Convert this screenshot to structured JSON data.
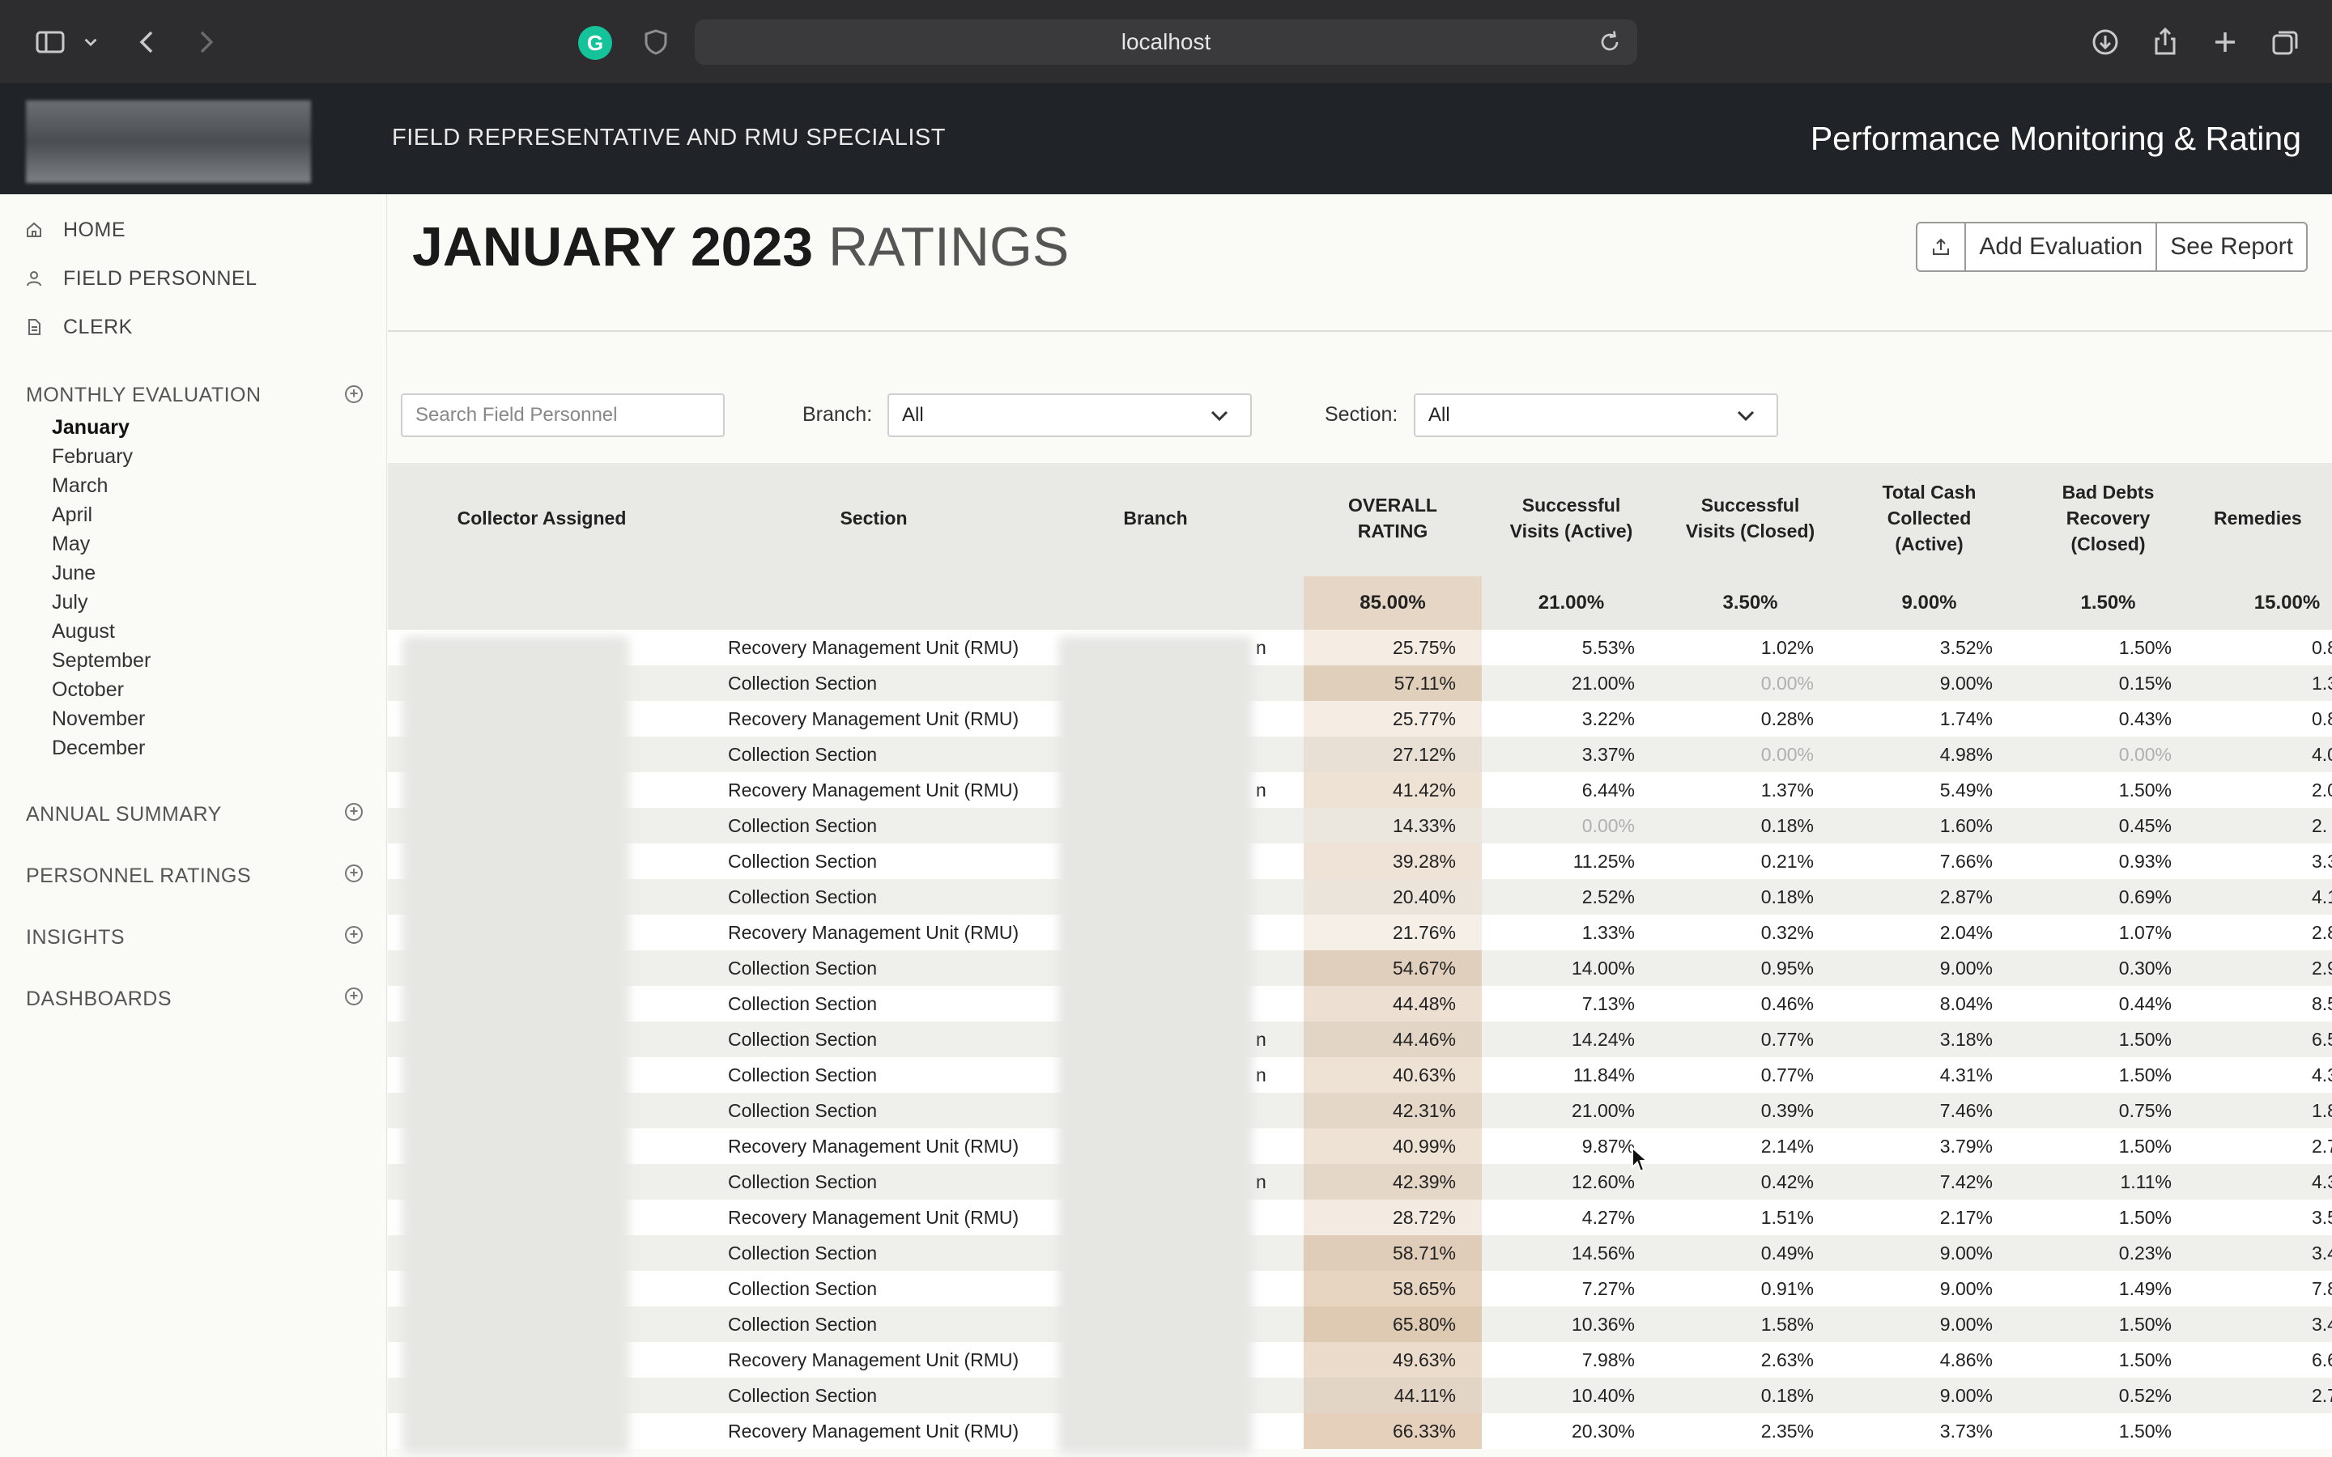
{
  "browser": {
    "url": "localhost"
  },
  "app": {
    "subtitle": "FIELD REPRESENTATIVE AND RMU SPECIALIST",
    "title": "Performance Monitoring & Rating"
  },
  "sidebar": {
    "nav": [
      {
        "label": "HOME",
        "icon": "home-icon"
      },
      {
        "label": "FIELD PERSONNEL",
        "icon": "person-icon"
      },
      {
        "label": "CLERK",
        "icon": "document-icon"
      }
    ],
    "monthly_evaluation": "MONTHLY EVALUATION",
    "months": [
      "January",
      "February",
      "March",
      "April",
      "May",
      "June",
      "July",
      "August",
      "September",
      "October",
      "November",
      "December"
    ],
    "active_month": "January",
    "sections": [
      "ANNUAL SUMMARY",
      "PERSONNEL RATINGS",
      "INSIGHTS",
      "DASHBOARDS"
    ]
  },
  "page": {
    "title_bold": "JANUARY 2023",
    "title_light": "RATINGS",
    "add_evaluation": "Add Evaluation",
    "see_report": "See Report"
  },
  "filters": {
    "search_placeholder": "Search Field Personnel",
    "branch_label": "Branch:",
    "branch_value": "All",
    "section_label": "Section:",
    "section_value": "All"
  },
  "table": {
    "headers": {
      "collector": "Collector Assigned",
      "section": "Section",
      "branch": "Branch",
      "rating_l1": "OVERALL",
      "rating_l2": "RATING",
      "sva_l1": "Successful",
      "sva_l2": "Visits (Active)",
      "svc_l1": "Successful",
      "svc_l2": "Visits (Closed)",
      "tcc_l1": "Total Cash",
      "tcc_l2": "Collected",
      "tcc_l3": "(Active)",
      "bdr_l1": "Bad Debts",
      "bdr_l2": "Recovery",
      "bdr_l3": "(Closed)",
      "rem": "Remedies"
    },
    "weights": {
      "rating": "85.00%",
      "sva": "21.00%",
      "svc": "3.50%",
      "tcc": "9.00%",
      "bdr": "1.50%",
      "rem": "15.00%"
    },
    "rows": [
      {
        "section": "Recovery Management Unit (RMU)",
        "rating": "25.75%",
        "sva": "5.53%",
        "svc": "1.02%",
        "tcc": "3.52%",
        "bdr": "1.50%",
        "rem": "0.8",
        "tail": "n",
        "r": 0.26
      },
      {
        "section": "Collection Section",
        "rating": "57.11%",
        "sva": "21.00%",
        "svc": "0.00%",
        "tcc": "9.00%",
        "bdr": "0.15%",
        "rem": "1.3",
        "tail": "",
        "r": 0.57
      },
      {
        "section": "Recovery Management Unit (RMU)",
        "rating": "25.77%",
        "sva": "3.22%",
        "svc": "0.28%",
        "tcc": "1.74%",
        "bdr": "0.43%",
        "rem": "0.8",
        "tail": "",
        "r": 0.26
      },
      {
        "section": "Collection Section",
        "rating": "27.12%",
        "sva": "3.37%",
        "svc": "0.00%",
        "tcc": "4.98%",
        "bdr": "0.00%",
        "rem": "4.0",
        "tail": "",
        "r": 0.27
      },
      {
        "section": "Recovery Management Unit (RMU)",
        "rating": "41.42%",
        "sva": "6.44%",
        "svc": "1.37%",
        "tcc": "5.49%",
        "bdr": "1.50%",
        "rem": "2.0",
        "tail": "n",
        "r": 0.41
      },
      {
        "section": "Collection Section",
        "rating": "14.33%",
        "sva": "0.00%",
        "svc": "0.18%",
        "tcc": "1.60%",
        "bdr": "0.45%",
        "rem": "2.",
        "tail": "",
        "r": 0.14
      },
      {
        "section": "Collection Section",
        "rating": "39.28%",
        "sva": "11.25%",
        "svc": "0.21%",
        "tcc": "7.66%",
        "bdr": "0.93%",
        "rem": "3.3",
        "tail": "",
        "r": 0.39
      },
      {
        "section": "Collection Section",
        "rating": "20.40%",
        "sva": "2.52%",
        "svc": "0.18%",
        "tcc": "2.87%",
        "bdr": "0.69%",
        "rem": "4.1",
        "tail": "",
        "r": 0.2
      },
      {
        "section": "Recovery Management Unit (RMU)",
        "rating": "21.76%",
        "sva": "1.33%",
        "svc": "0.32%",
        "tcc": "2.04%",
        "bdr": "1.07%",
        "rem": "2.8",
        "tail": "",
        "r": 0.22
      },
      {
        "section": "Collection Section",
        "rating": "54.67%",
        "sva": "14.00%",
        "svc": "0.95%",
        "tcc": "9.00%",
        "bdr": "0.30%",
        "rem": "2.9",
        "tail": "",
        "r": 0.55
      },
      {
        "section": "Collection Section",
        "rating": "44.48%",
        "sva": "7.13%",
        "svc": "0.46%",
        "tcc": "8.04%",
        "bdr": "0.44%",
        "rem": "8.5",
        "tail": "",
        "r": 0.44
      },
      {
        "section": "Collection Section",
        "rating": "44.46%",
        "sva": "14.24%",
        "svc": "0.77%",
        "tcc": "3.18%",
        "bdr": "1.50%",
        "rem": "6.5",
        "tail": "n",
        "r": 0.44
      },
      {
        "section": "Collection Section",
        "rating": "40.63%",
        "sva": "11.84%",
        "svc": "0.77%",
        "tcc": "4.31%",
        "bdr": "1.50%",
        "rem": "4.3",
        "tail": "n",
        "r": 0.41
      },
      {
        "section": "Collection Section",
        "rating": "42.31%",
        "sva": "21.00%",
        "svc": "0.39%",
        "tcc": "7.46%",
        "bdr": "0.75%",
        "rem": "1.8",
        "tail": "",
        "r": 0.42
      },
      {
        "section": "Recovery Management Unit (RMU)",
        "rating": "40.99%",
        "sva": "9.87%",
        "svc": "2.14%",
        "tcc": "3.79%",
        "bdr": "1.50%",
        "rem": "2.7",
        "tail": "",
        "r": 0.41
      },
      {
        "section": "Collection Section",
        "rating": "42.39%",
        "sva": "12.60%",
        "svc": "0.42%",
        "tcc": "7.42%",
        "bdr": "1.11%",
        "rem": "4.3",
        "tail": "n",
        "r": 0.42
      },
      {
        "section": "Recovery Management Unit (RMU)",
        "rating": "28.72%",
        "sva": "4.27%",
        "svc": "1.51%",
        "tcc": "2.17%",
        "bdr": "1.50%",
        "rem": "3.5",
        "tail": "",
        "r": 0.29
      },
      {
        "section": "Collection Section",
        "rating": "58.71%",
        "sva": "14.56%",
        "svc": "0.49%",
        "tcc": "9.00%",
        "bdr": "0.23%",
        "rem": "3.4",
        "tail": "",
        "r": 0.59
      },
      {
        "section": "Collection Section",
        "rating": "58.65%",
        "sva": "7.27%",
        "svc": "0.91%",
        "tcc": "9.00%",
        "bdr": "1.49%",
        "rem": "7.8",
        "tail": "",
        "r": 0.59
      },
      {
        "section": "Collection Section",
        "rating": "65.80%",
        "sva": "10.36%",
        "svc": "1.58%",
        "tcc": "9.00%",
        "bdr": "1.50%",
        "rem": "3.4",
        "tail": "",
        "r": 0.66
      },
      {
        "section": "Recovery Management Unit (RMU)",
        "rating": "49.63%",
        "sva": "7.98%",
        "svc": "2.63%",
        "tcc": "4.86%",
        "bdr": "1.50%",
        "rem": "6.6",
        "tail": "",
        "r": 0.5
      },
      {
        "section": "Collection Section",
        "rating": "44.11%",
        "sva": "10.40%",
        "svc": "0.18%",
        "tcc": "9.00%",
        "bdr": "0.52%",
        "rem": "2.7",
        "tail": "",
        "r": 0.44
      },
      {
        "section": "Recovery Management Unit (RMU)",
        "rating": "66.33%",
        "sva": "20.30%",
        "svc": "2.35%",
        "tcc": "3.73%",
        "bdr": "1.50%",
        "rem": "",
        "tail": "",
        "r": 0.66
      }
    ],
    "rating_color": "#d2b08c",
    "muted_value": "0.00%"
  }
}
